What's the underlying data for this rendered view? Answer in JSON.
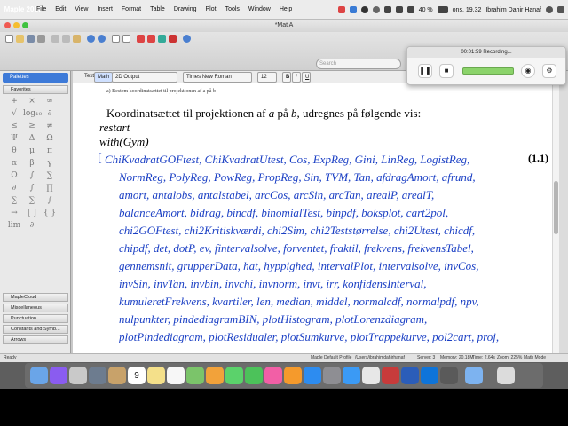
{
  "menubar": {
    "app_name": "Maple 2017",
    "items": [
      "File",
      "Edit",
      "View",
      "Insert",
      "Format",
      "Table",
      "Drawing",
      "Plot",
      "Tools",
      "Window",
      "Help"
    ],
    "battery": "40 %",
    "clock": "ons. 19.32",
    "user": "Ibrahim Dahir Hanaf"
  },
  "window": {
    "title": "*Mat A"
  },
  "toolbar": {
    "search_placeholder": "Search",
    "mode_text": "Text",
    "mode_math": "Math",
    "output_style": "2D Output",
    "font": "Times New Roman",
    "font_size": "12",
    "bold": "B",
    "italic": "I",
    "underline": "U"
  },
  "palette": {
    "header": "Palettes",
    "favorites": "Favorites",
    "symbols": [
      "+",
      "×",
      "∞",
      "√",
      "log₁₀",
      "∂",
      "≤",
      "≥",
      "≠",
      "Ψ",
      "Δ",
      "Ω",
      "θ",
      "μ",
      "π",
      "α",
      "β",
      "γ",
      "Ω",
      "∫",
      "∑",
      "∂",
      "∫",
      "∏",
      "∑",
      "∑",
      "∫",
      "→",
      "[ ]",
      "{ }",
      "lim",
      "∂"
    ],
    "sections": [
      "MapleCloud",
      "Miscellaneous",
      "Punctuation",
      "Constants and Symb...",
      "Arrows"
    ]
  },
  "document": {
    "small_heading": "a)   Bestem koordinatsættet til projektionen af a på b",
    "sentence": "Koordinatsættet til projektionen af",
    "sentence_a": "a",
    "sentence_mid": "på",
    "sentence_b": "b",
    "sentence_end": ", udregnes på følgende vis:",
    "cmd1": "restart",
    "cmd2": "with(Gym)",
    "equation_label": "(1.1)",
    "output_lines": [
      "ChiKvadratGOFtest, ChiKvadratUtest, Cos, ExpReg, Gini, LinReg, LogistReg,",
      "NormReg, PolyReg, PowReg, PropReg, Sin, TVM, Tan, afdragAmort, afrund,",
      "amort, antalobs, antalstabel, arcCos, arcSin, arcTan, arealP, arealT,",
      "balanceAmort, bidrag, bincdf, binomialTest, binpdf, boksplot, cart2pol,",
      "chi2GOFtest, chi2Kritiskværdi, chi2Sim, chi2Teststørrelse, chi2Utest, chicdf,",
      "chipdf, det, dotP, ev, fintervalsolve, forventet, fraktil, frekvens, frekvensTabel,",
      "gennemsnit, grupperData, hat, hyppighed, intervalPlot, intervalsolve, invCos,",
      "invSin, invTan, invbin, invchi, invnorm, invt, irr, konfidensInterval,",
      "kumuleretFrekvens, kvartiler, len, median, middel, normalcdf, normalpdf, npv,",
      "nulpunkter, pindediagramBIN, plotHistogram, plotLorenzdiagram,",
      "plotPindediagram, plotResidualer, plotSumkurve, plotTrappekurve, pol2cart, proj,"
    ]
  },
  "statusbar": {
    "left": "Ready",
    "profile": "Maple Default Profile",
    "path": "/Users/ibrahimdahirhanaf",
    "server": "Server: 3",
    "memory": "Memory: 20.18M",
    "time": "Time: 2.64s",
    "zoom": "Zoom: 225%",
    "mode": "Math Mode"
  },
  "recorder": {
    "title": "00:01:59 Recording..."
  },
  "dock": {
    "calendar_day": "9",
    "apps": [
      "finder",
      "siri",
      "launchpad",
      "rocket",
      "contacts",
      "calendar",
      "notes",
      "reminders",
      "maps",
      "photos",
      "messages",
      "facetime",
      "itunes",
      "ibooks",
      "appstore",
      "preferences",
      "safari",
      "chrome",
      "maple",
      "word",
      "teamviewer",
      "screen-recorder",
      "folder",
      "trash"
    ]
  },
  "colors": {
    "output_blue": "#1a3fc4",
    "palette_blue": "#3d7ad8",
    "recording_green": "#8bd36a"
  }
}
